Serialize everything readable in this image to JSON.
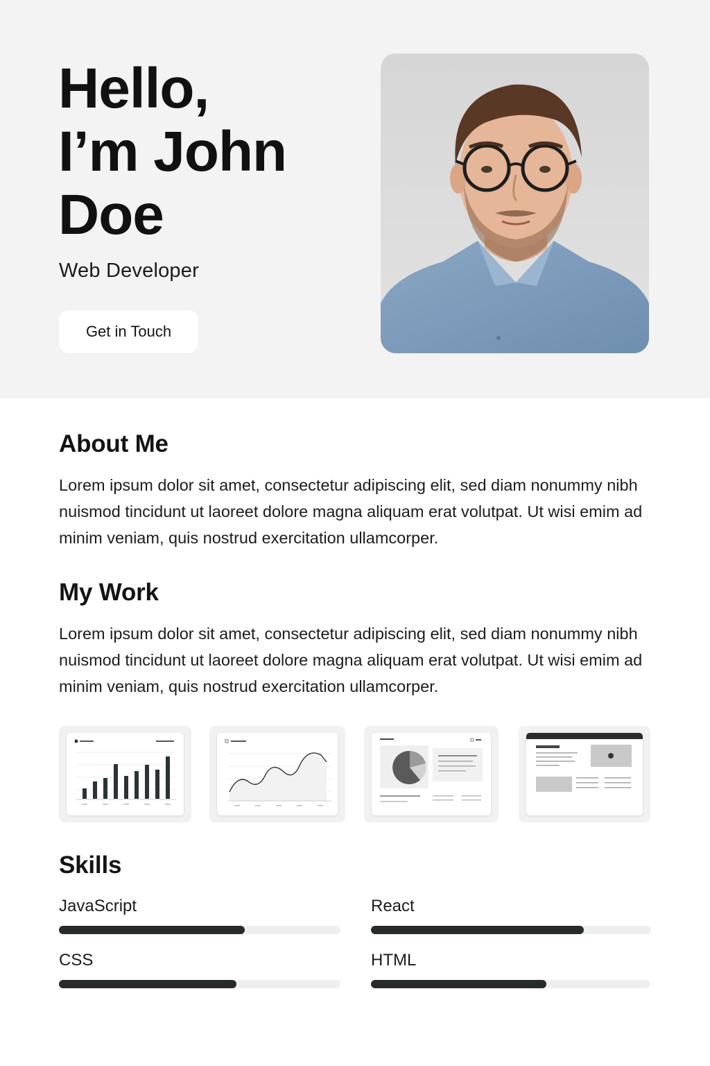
{
  "hero": {
    "title_lines": [
      "Hello,",
      "I’m John",
      "Doe"
    ],
    "subtitle": "Web Developer",
    "cta_label": "Get in Touch"
  },
  "about": {
    "title": "About Me",
    "body": "Lorem ipsum dolor sit amet, consectetur adipiscing elit, sed diam nonummy nibh nuismod tincidunt ut laoreet dolore magna aliquam erat volutpat. Ut wisi emim ad minim veniam, quis nostrud exercitation ullamcorper."
  },
  "work": {
    "title": "My Work",
    "body": "Lorem ipsum dolor sit amet, consectetur adipiscing elit, sed diam nonummy nibh nuismod tincidunt ut laoreet dolore magna aliquam erat volutpat. Ut wisi emim ad minim veniam, quis nostrud exercitation ullamcorper.",
    "projects": [
      {
        "kind": "bar-chart-dashboard",
        "icon": "bar-chart-icon"
      },
      {
        "kind": "line-chart-dashboard",
        "icon": "line-chart-icon"
      },
      {
        "kind": "pie-chart-dashboard",
        "icon": "pie-chart-icon"
      },
      {
        "kind": "website-layout",
        "icon": "image-placeholder-icon"
      }
    ]
  },
  "skills": {
    "title": "Skills",
    "items": [
      {
        "name": "JavaScript",
        "level": 0.66
      },
      {
        "name": "React",
        "level": 0.76
      },
      {
        "name": "CSS",
        "level": 0.63
      },
      {
        "name": "HTML",
        "level": 0.63
      }
    ]
  },
  "colors": {
    "hero_bg": "#f3f3f3",
    "bar_fill": "#262b2c",
    "bar_track": "#efefef",
    "shirt": "#7f9dbd"
  }
}
